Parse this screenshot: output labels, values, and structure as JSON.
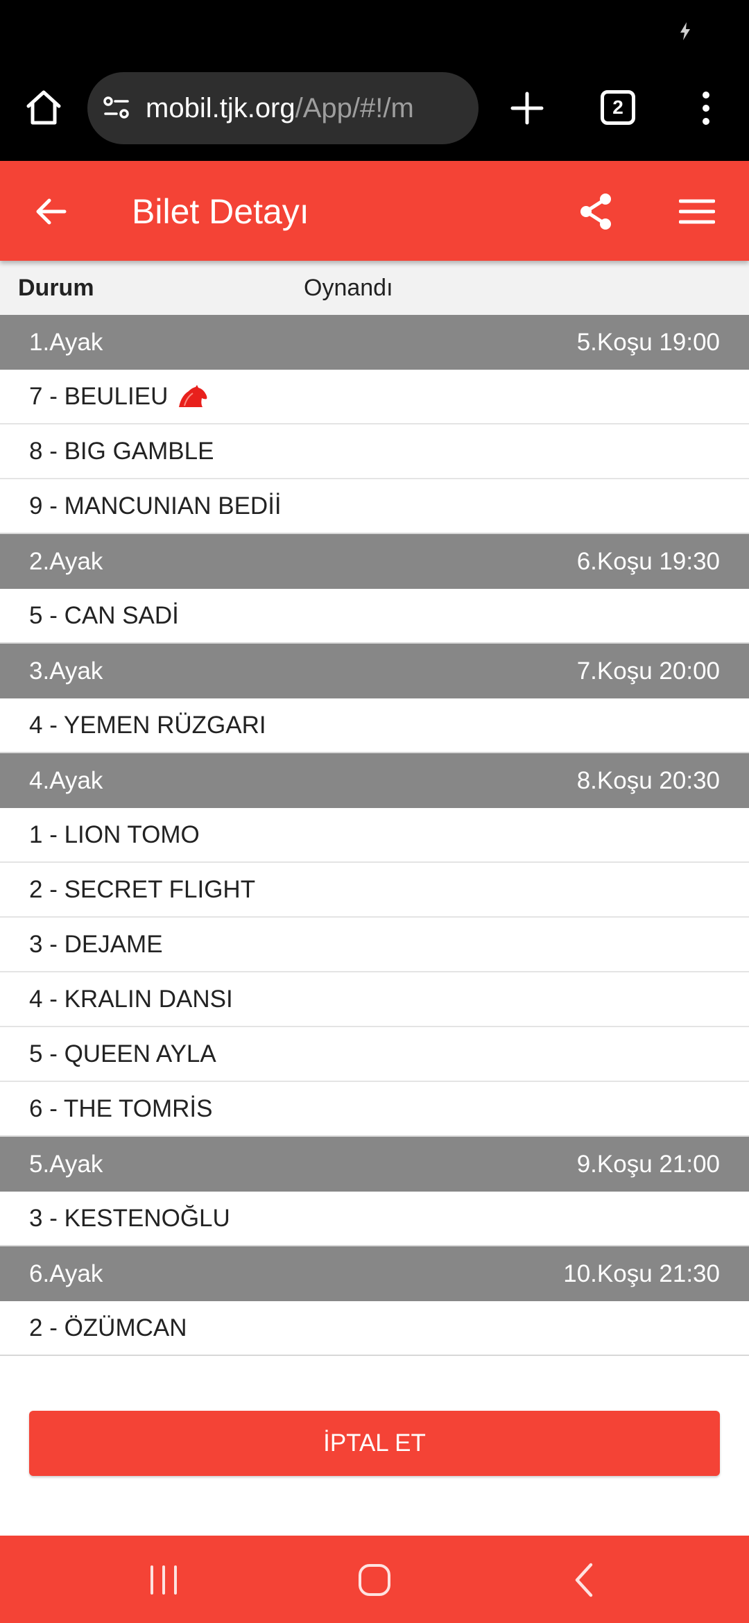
{
  "browser": {
    "url_host": "mobil.tjk.org",
    "url_path": "/App/#!/m",
    "tab_count": "2"
  },
  "header": {
    "title": "Bilet Detayı"
  },
  "status": {
    "label": "Durum",
    "value": "Oynandı"
  },
  "legs": [
    {
      "leg": "1.Ayak",
      "race": "5.Koşu 19:00",
      "horses": [
        {
          "name": "7 - BEULIEU",
          "favorite": true
        },
        {
          "name": "8 - BIG GAMBLE"
        },
        {
          "name": "9 - MANCUNIAN BEDİİ"
        }
      ]
    },
    {
      "leg": "2.Ayak",
      "race": "6.Koşu 19:30",
      "horses": [
        {
          "name": "5 - CAN SADİ"
        }
      ]
    },
    {
      "leg": "3.Ayak",
      "race": "7.Koşu 20:00",
      "horses": [
        {
          "name": "4 - YEMEN RÜZGARI"
        }
      ]
    },
    {
      "leg": "4.Ayak",
      "race": "8.Koşu 20:30",
      "horses": [
        {
          "name": "1 - LION TOMO"
        },
        {
          "name": "2 - SECRET FLIGHT"
        },
        {
          "name": "3 - DEJAME"
        },
        {
          "name": "4 - KRALIN DANSI"
        },
        {
          "name": "5 - QUEEN AYLA"
        },
        {
          "name": "6 - THE TOMRİS"
        }
      ]
    },
    {
      "leg": "5.Ayak",
      "race": "9.Koşu 21:00",
      "horses": [
        {
          "name": "3 - KESTENOĞLU"
        }
      ]
    },
    {
      "leg": "6.Ayak",
      "race": "10.Koşu 21:30",
      "horses": [
        {
          "name": "2 - ÖZÜMCAN"
        }
      ]
    }
  ],
  "actions": {
    "cancel_label": "İPTAL ET"
  },
  "colors": {
    "primary": "#f44336",
    "leg_header": "#878787",
    "favorite_icon": "#e8201c"
  },
  "icons": {
    "home": "home-icon",
    "site_settings": "site-settings-icon",
    "new_tab": "plus-icon",
    "back": "arrow-left-icon",
    "share": "share-icon",
    "menu": "hamburger-icon",
    "favorite": "horse-head-icon"
  }
}
